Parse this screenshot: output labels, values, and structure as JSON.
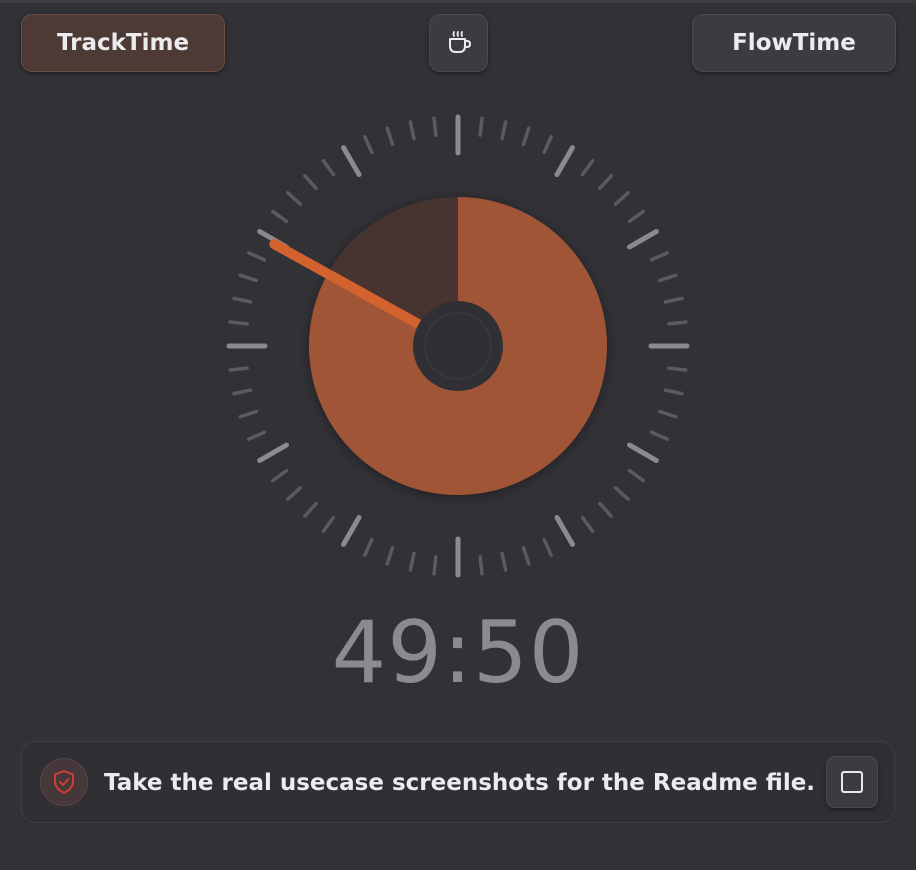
{
  "header": {
    "left_button_label": "TrackTime",
    "right_button_label": "FlowTime",
    "center_button_icon": "coffee-cup-icon"
  },
  "timer": {
    "display": "49:50",
    "elapsed_fraction": 0.83,
    "hand_angle_degrees": -61
  },
  "task": {
    "text": "Take the real usecase screenshots for the Readme file.",
    "icon": "shield-check-icon",
    "completed": false
  },
  "colors": {
    "background": "#313136",
    "accent": "#a05636",
    "hand": "#d4622f",
    "remaining": "#473431",
    "ticks": "#6e6e73"
  }
}
